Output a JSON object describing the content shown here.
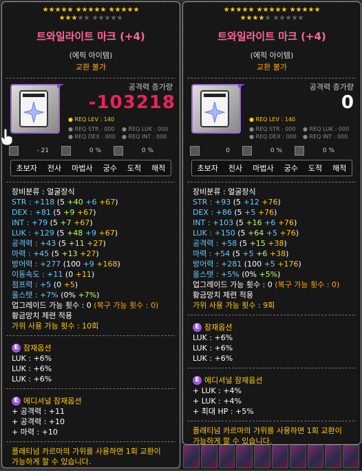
{
  "stars_left": {
    "row1": "★★★★★ ★★★★★ ★★★★★",
    "row2_on": "★★★",
    "row2_off": "★★ ★★★★★"
  },
  "stars_right": {
    "row1": "★★★★★ ★★★★★ ★★★★★",
    "row2_on": "★★★★",
    "row2_off": "★ ★★★★★"
  },
  "left": {
    "title": "트와일라이트 마크 (+4)",
    "grade": "(에픽 아이템)",
    "trade": "교환 불가",
    "atk_label": "공격력 증가량",
    "atk_value": "-103218",
    "req_lev": "● REQ LEV : 140",
    "req": [
      "● REQ STR : 000",
      "● REQ LUK : 000",
      "● REQ DEX : 000",
      "● REQ INT : 000"
    ],
    "mini_stats": [
      "- 21",
      "0 %",
      "0 %"
    ],
    "jobs": [
      "초보자",
      "전사",
      "마법사",
      "궁수",
      "도적",
      "해적"
    ],
    "category": "장비분류 : 얼굴장식",
    "stats": [
      {
        "label": "STR : +118",
        "base": " (5 ",
        "parts": [
          {
            "t": "+40",
            "c": "green"
          },
          {
            "t": " +6",
            "c": "cyan"
          },
          {
            "t": " +67",
            "c": "yellow"
          }
        ]
      },
      {
        "label": "DEX : +81",
        "base": " (5 ",
        "parts": [
          {
            "t": "+9",
            "c": "green"
          },
          {
            "t": " +67",
            "c": "yellow"
          }
        ]
      },
      {
        "label": "INT : +79",
        "base": " (5 ",
        "parts": [
          {
            "t": "+7",
            "c": "green"
          },
          {
            "t": " +67",
            "c": "yellow"
          }
        ]
      },
      {
        "label": "LUK : +129",
        "base": " (5 ",
        "parts": [
          {
            "t": "+48",
            "c": "green"
          },
          {
            "t": " +9",
            "c": "cyan"
          },
          {
            "t": " +67",
            "c": "yellow"
          }
        ]
      },
      {
        "label": "공격력 : +43",
        "base": " (5 ",
        "parts": [
          {
            "t": "+11",
            "c": "green"
          },
          {
            "t": " +27",
            "c": "yellow"
          }
        ]
      },
      {
        "label": "마력 : +45",
        "base": " (5 ",
        "parts": [
          {
            "t": "+13",
            "c": "green"
          },
          {
            "t": " +27",
            "c": "yellow"
          }
        ]
      },
      {
        "label": "방어력 : +277",
        "base": " (100 ",
        "parts": [
          {
            "t": "+9",
            "c": "cyan"
          },
          {
            "t": " +168",
            "c": "yellow"
          }
        ]
      },
      {
        "label": "이동속도 : +11",
        "base": " (0 ",
        "parts": [
          {
            "t": "+11",
            "c": "yellow"
          }
        ]
      },
      {
        "label": "점프력 : +5",
        "base": " (0 ",
        "parts": [
          {
            "t": "+5",
            "c": "yellow"
          }
        ]
      },
      {
        "label": "올스탯 : +7%",
        "base": " (0% ",
        "parts": [
          {
            "t": "+7%",
            "c": "green"
          }
        ]
      }
    ],
    "upgrade": "업그레이드 가능 횟수 : 0",
    "upgrade_extra": " (복구 가능 횟수 : 0)",
    "golden": "황금망치 제련 적용",
    "scissors": "가위 사용 가능 횟수 : 10회",
    "potential_hdr": "잠재옵션",
    "potential": [
      "LUK : +6%",
      "LUK : +6%",
      "LUK : +6%"
    ],
    "additional_hdr": "에디셔널 잠재옵션",
    "additional": [
      "+ 공격력 : +11",
      "+ 공격력 : +10",
      "+ 마력 : +10"
    ],
    "note": "플래티넘 카르마의 가위를 사용하면 1회 교환이 가능하게 할 수 있습니다."
  },
  "right": {
    "title": "트와일라이트 마크 (+4)",
    "grade": "(에픽 아이템)",
    "trade": "교환 불가",
    "atk_label": "공격력 증가량",
    "atk_value": "0",
    "req_lev": "● REQ LEV : 140",
    "req": [
      "● REQ STR : 000",
      "● REQ LUK : 000",
      "● REQ DEX : 000",
      "● REQ INT : 000"
    ],
    "mini_stats": [
      "0",
      "0 %",
      "0 %"
    ],
    "jobs": [
      "초보자",
      "전사",
      "마법사",
      "궁수",
      "도적",
      "해적"
    ],
    "category": "장비분류 : 얼굴장식",
    "stats": [
      {
        "label": "STR : +93",
        "base": " (5 ",
        "parts": [
          {
            "t": "+12",
            "c": "cyan"
          },
          {
            "t": " +76",
            "c": "yellow"
          }
        ]
      },
      {
        "label": "DEX : +86",
        "base": " (5 ",
        "parts": [
          {
            "t": "+5",
            "c": "cyan"
          },
          {
            "t": " +76",
            "c": "yellow"
          }
        ]
      },
      {
        "label": "INT : +103",
        "base": " (5 ",
        "parts": [
          {
            "t": "+16",
            "c": "green"
          },
          {
            "t": " +6",
            "c": "cyan"
          },
          {
            "t": " +76",
            "c": "yellow"
          }
        ]
      },
      {
        "label": "LUK : +150",
        "base": " (5 ",
        "parts": [
          {
            "t": "+64",
            "c": "green"
          },
          {
            "t": " +5",
            "c": "cyan"
          },
          {
            "t": " +76",
            "c": "yellow"
          }
        ]
      },
      {
        "label": "공격력 : +58",
        "base": " (5 ",
        "parts": [
          {
            "t": "+15",
            "c": "green"
          },
          {
            "t": " +38",
            "c": "yellow"
          }
        ]
      },
      {
        "label": "마력 : +54",
        "base": " (5 ",
        "parts": [
          {
            "t": "+5",
            "c": "cyan"
          },
          {
            "t": " +6",
            "c": "green"
          },
          {
            "t": " +38",
            "c": "yellow"
          }
        ]
      },
      {
        "label": "방어력 : +281",
        "base": " (100 ",
        "parts": [
          {
            "t": "+5",
            "c": "cyan"
          },
          {
            "t": " +176",
            "c": "yellow"
          }
        ]
      },
      {
        "label": "올스탯 : +5%",
        "base": " (0% ",
        "parts": [
          {
            "t": "+5%",
            "c": "green"
          }
        ]
      }
    ],
    "upgrade": "업그레이드 가능 횟수 : 0",
    "upgrade_extra": " (복구 가능 횟수 : 0)",
    "golden": "황금망치 제련 적용",
    "scissors": "가위 사용 가능 횟수 : 9회",
    "potential_hdr": "잠재옵션",
    "potential": [
      "LUK : +6%",
      "LUK : +6%",
      "LUK : +6%"
    ],
    "additional_hdr": "에디셔널 잠재옵션",
    "additional": [
      "+ LUK : +4%",
      "+ LUK : +4%",
      "+ 최대 HP : +5%"
    ],
    "note": "플래티넘 카르마의 가위를 사용하면 1회 교환이 가능하게 할 수 있습니다."
  },
  "colors": {
    "title": "#ff6699",
    "atk_negative": "#e8255a",
    "scissors": "#ffcc00"
  }
}
